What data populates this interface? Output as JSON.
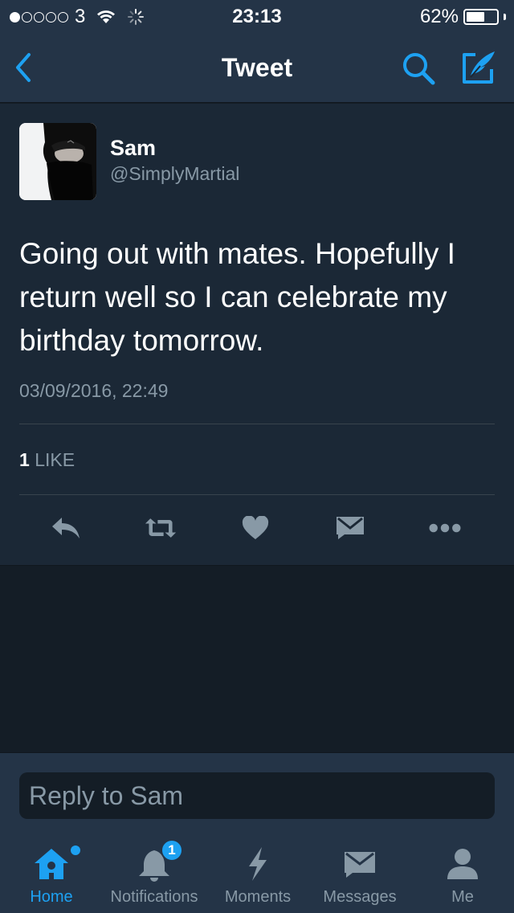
{
  "status_bar": {
    "signal_bars_filled": 1,
    "signal_bars_total": 5,
    "carrier": "3",
    "time": "23:13",
    "battery_percent": "62%",
    "battery_level": 0.62
  },
  "nav": {
    "title": "Tweet",
    "accent_color": "#1da1f2"
  },
  "tweet": {
    "author_name": "Sam",
    "author_handle": "@SimplyMartial",
    "text": "Going out with mates. Hopefully I return well so I can celebrate my birthday tomorrow.",
    "timestamp": "03/09/2016, 22:49",
    "like_count": "1",
    "like_label": "LIKE"
  },
  "actions": [
    "reply-icon",
    "retweet-icon",
    "heart-icon",
    "envelope-icon",
    "more-icon"
  ],
  "reply": {
    "placeholder": "Reply to Sam"
  },
  "tabs": [
    {
      "label": "Home",
      "icon": "home-icon",
      "active": true
    },
    {
      "label": "Notifications",
      "icon": "bell-icon",
      "badge": "1"
    },
    {
      "label": "Moments",
      "icon": "lightning-icon"
    },
    {
      "label": "Messages",
      "icon": "envelope-icon"
    },
    {
      "label": "Me",
      "icon": "person-icon"
    }
  ]
}
